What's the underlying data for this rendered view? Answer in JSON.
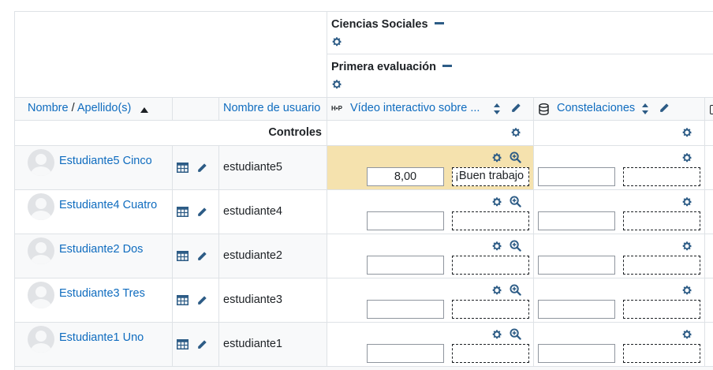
{
  "categories": {
    "parent": {
      "name": "Ciencias Sociales"
    },
    "child": {
      "name": "Primera evaluación"
    }
  },
  "columns": {
    "name_label": "Nombre",
    "separator": " / ",
    "surname_label": "Apellido(s)",
    "username_label": "Nombre de usuario",
    "item1": {
      "icon_text": "H•P",
      "label": "Vídeo interactivo sobre ..."
    },
    "item2": {
      "label": "Constelaciones"
    }
  },
  "controls_label": "Controles",
  "rows": [
    {
      "name": "Estudiante5 Cinco",
      "username": "estudiante5",
      "grade": "8,00",
      "feedback": "¡Buen trabajo",
      "grade2": "",
      "feedback2": ""
    },
    {
      "name": "Estudiante4 Cuatro",
      "username": "estudiante4",
      "grade": "",
      "feedback": "",
      "grade2": "",
      "feedback2": ""
    },
    {
      "name": "Estudiante2 Dos",
      "username": "estudiante2",
      "grade": "",
      "feedback": "",
      "grade2": "",
      "feedback2": ""
    },
    {
      "name": "Estudiante3 Tres",
      "username": "estudiante3",
      "grade": "",
      "feedback": "",
      "grade2": "",
      "feedback2": ""
    },
    {
      "name": "Estudiante1 Uno",
      "username": "estudiante1",
      "grade": "",
      "feedback": "",
      "grade2": "",
      "feedback2": ""
    }
  ],
  "colors": {
    "link": "#0f6cbf",
    "icon": "#2d5c86",
    "highlight": "#f5e2ae"
  }
}
